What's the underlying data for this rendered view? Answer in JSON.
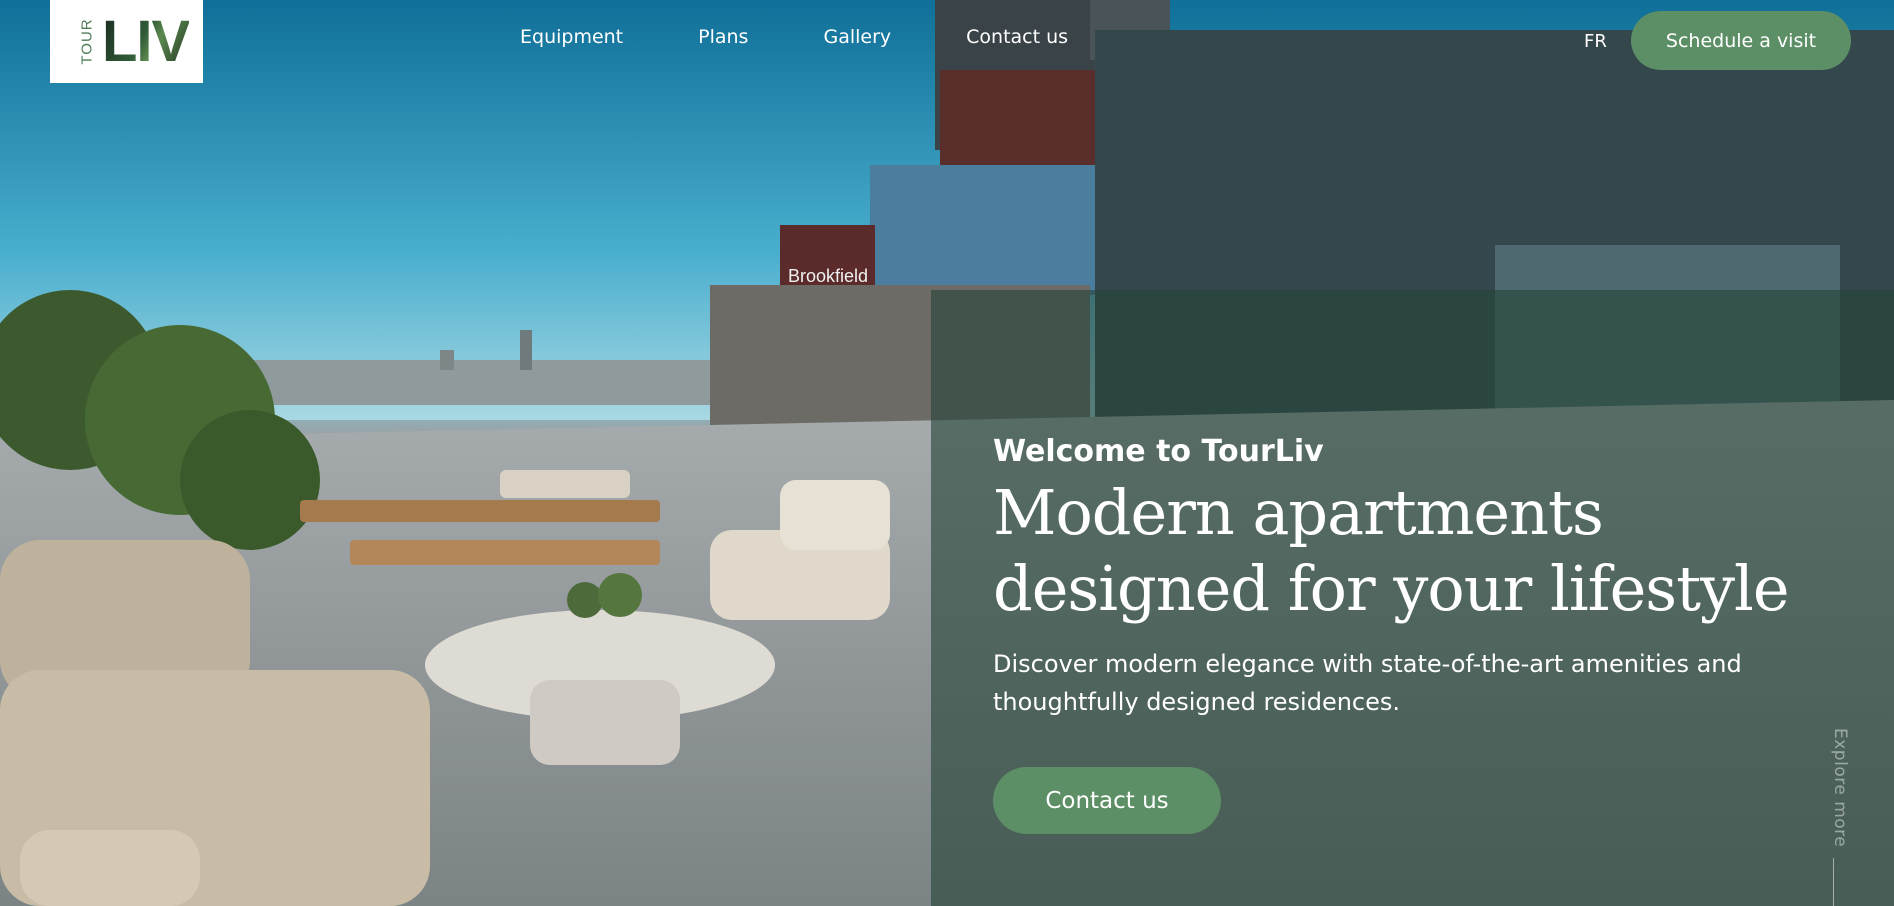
{
  "logo": {
    "small_text": "TOUR",
    "big_text": "LIV"
  },
  "nav": {
    "items": [
      {
        "label": "Equipment"
      },
      {
        "label": "Plans"
      },
      {
        "label": "Gallery"
      },
      {
        "label": "Contact us"
      }
    ]
  },
  "header": {
    "language": "FR",
    "schedule_label": "Schedule a visit"
  },
  "hero": {
    "welcome": "Welcome to TourLiv",
    "headline_line1": "Modern apartments",
    "headline_line2": "designed for your lifestyle",
    "description_line1": "Discover modern elegance with state-of-the-art amenities and",
    "description_line2": "thoughtfully designed residences.",
    "cta_label": "Contact us",
    "explore_label": "Explore more",
    "building_sign": "Brookfield"
  },
  "colors": {
    "accent": "#5d8f66",
    "overlay": "#264638"
  }
}
